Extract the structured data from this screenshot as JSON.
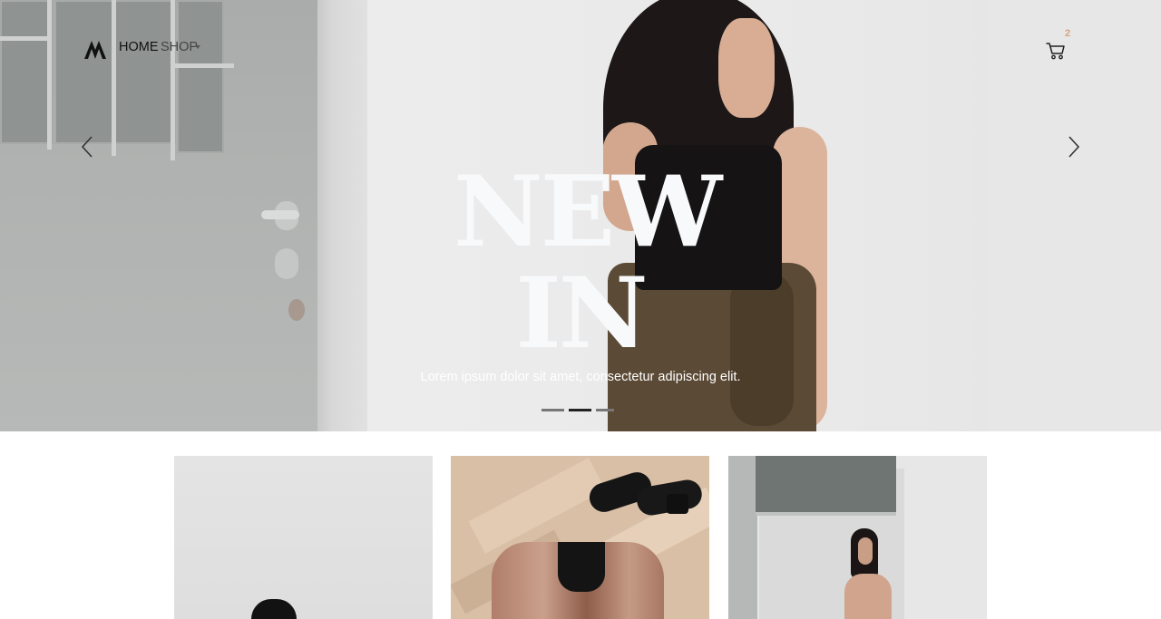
{
  "nav": {
    "home_label": "HOME",
    "shop_label": "SHOP",
    "cart_count": "2",
    "logo_icon": "brand-logo-icon",
    "cart_icon": "shopping-cart-icon",
    "caret_icon": "chevron-down-icon"
  },
  "hero": {
    "headline_line1": "NEW",
    "headline_line2": "IN",
    "subtitle": "Lorem ipsum dolor sit amet, consectetur adipiscing elit.",
    "prev_icon": "chevron-left-icon",
    "next_icon": "chevron-right-icon",
    "slide_count": 3,
    "active_slide": 2
  },
  "products": [
    {
      "id": "card-1",
      "image": "white wall with black shoe"
    },
    {
      "id": "card-2",
      "image": "sequin jacket and black sandals on parquet"
    },
    {
      "id": "card-3",
      "image": "woman standing by white wall"
    }
  ],
  "colors": {
    "accent": "#d9a27f",
    "nav_text": "#111111",
    "headline": "#f8f9fb"
  }
}
